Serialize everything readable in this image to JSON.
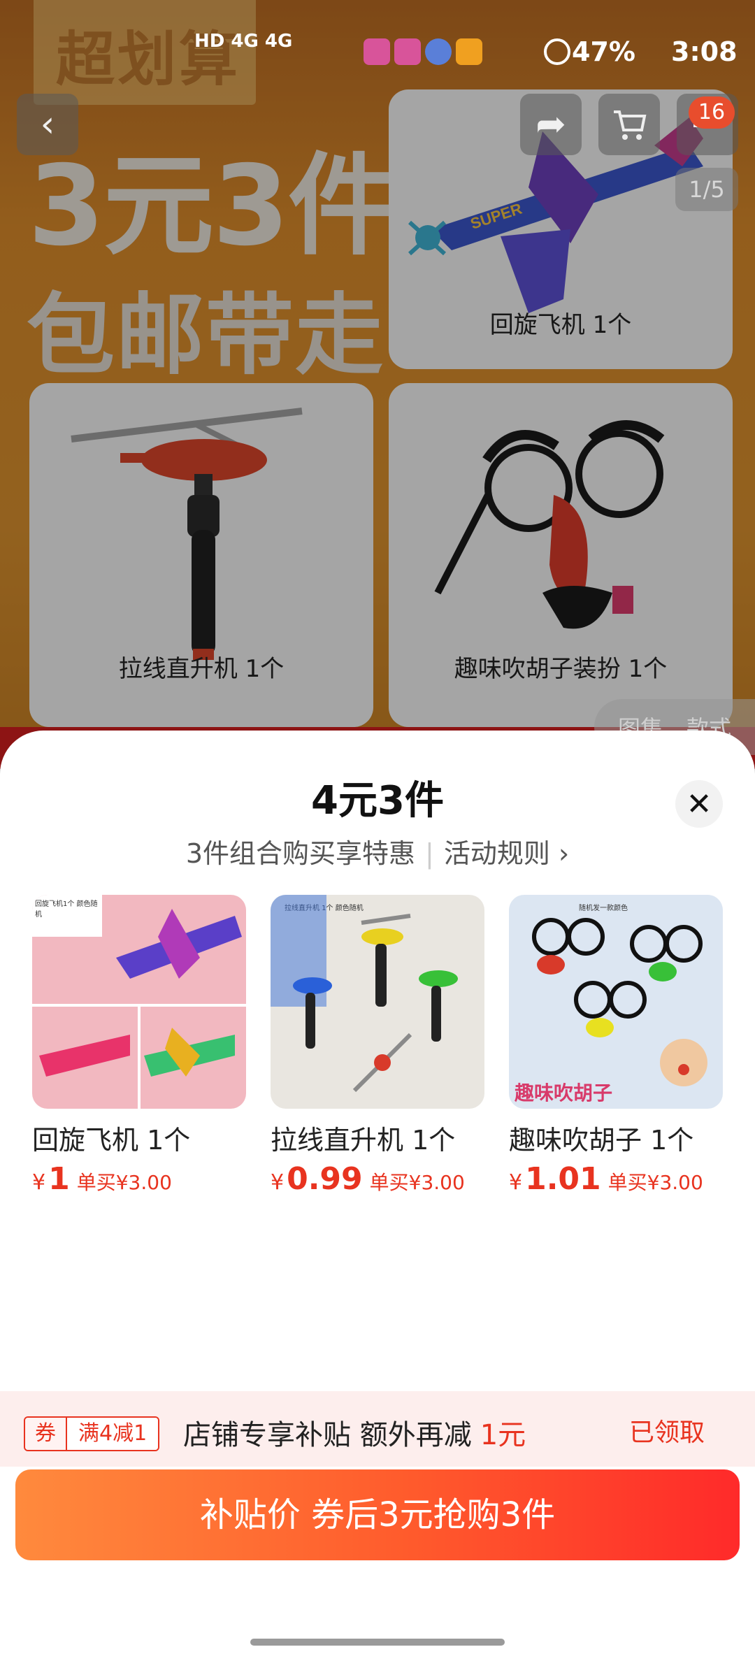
{
  "status_bar": {
    "network": "HD 4G 4G",
    "battery": "47%",
    "time": "3:08"
  },
  "header": {
    "cart_count": "16",
    "page_indicator": "1/5"
  },
  "banner": {
    "tag": "超划算",
    "headline": "3元3件",
    "subline": "包邮带走"
  },
  "bg_items": [
    {
      "label": "回旋飞机 1个"
    },
    {
      "label": "拉线直升机 1个"
    },
    {
      "label": "趣味吹胡子装扮 1个"
    }
  ],
  "gallery_tabs": [
    "图集",
    "款式"
  ],
  "sheet": {
    "title": "4元3件",
    "subtitle": "3件组合购买享特惠",
    "rules_link": "活动规则 ›",
    "products": [
      {
        "name": "回旋飞机 1个",
        "yen": "¥",
        "price": "1",
        "single": "单买¥3.00",
        "img_caption": "回旋飞机1个 颜色随机"
      },
      {
        "name": "拉线直升机 1个",
        "yen": "¥",
        "price": "0.99",
        "single": "单买¥3.00",
        "img_caption": "拉线直升机 1个 颜色随机"
      },
      {
        "name": "趣味吹胡子 1个",
        "yen": "¥",
        "price": "1.01",
        "single": "单买¥3.00",
        "img_caption": "随机发一款颜色",
        "img_footer": "趣味吹胡子"
      }
    ]
  },
  "coupon": {
    "tag_left": "券",
    "tag_right": "满4减1",
    "text": "店铺专享补贴 额外再减",
    "amount": "1元",
    "status": "已领取"
  },
  "buy_button": "补贴价 券后3元抢购3件",
  "colors": {
    "accent_red": "#e8331f",
    "button_start": "#ff8a3d",
    "button_end": "#ff2a2a"
  }
}
